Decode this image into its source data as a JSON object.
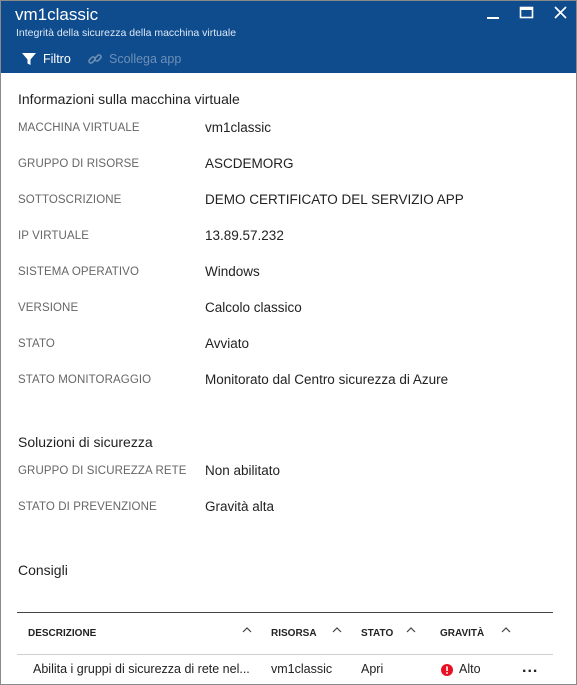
{
  "header": {
    "title": "vm1classic",
    "subtitle": "Integrità della sicurezza della macchina virtuale",
    "toolbar": {
      "filter_label": "Filtro",
      "disconnect_label": "Scollega app"
    },
    "window_controls": [
      "minimize-icon",
      "maximize-icon",
      "close-icon"
    ]
  },
  "vm_info": {
    "title": "Informazioni sulla macchina virtuale",
    "props": [
      {
        "label": "MACCHINA VIRTUALE",
        "value": "vm1classic"
      },
      {
        "label": "GRUPPO DI RISORSE",
        "value": "ASCDEMORG"
      },
      {
        "label": "SOTTOSCRIZIONE",
        "value": "DEMO CERTIFICATO DEL SERVIZIO APP"
      },
      {
        "label": "IP VIRTUALE",
        "value": "13.89.57.232"
      },
      {
        "label": "SISTEMA OPERATIVO",
        "value": "Windows"
      },
      {
        "label": "VERSIONE",
        "value": "Calcolo classico"
      },
      {
        "label": "STATO",
        "value": "Avviato"
      },
      {
        "label": "STATO MONITORAGGIO",
        "value": "Monitorato dal Centro sicurezza di Azure"
      }
    ]
  },
  "security_solutions": {
    "title": "Soluzioni di sicurezza",
    "props": [
      {
        "label": "GRUPPO DI SICUREZZA RETE",
        "value": "Non abilitato"
      },
      {
        "label": "STATO DI PREVENZIONE",
        "value": "Gravità alta"
      }
    ]
  },
  "recommendations": {
    "title": "Consigli",
    "columns": [
      "DESCRIZIONE",
      "RISORSA",
      "STATO",
      "GRAVITÀ"
    ],
    "rows": [
      {
        "description": "Abilita i gruppi di sicurezza di rete nel...",
        "resource": "vm1classic",
        "status": "Apri",
        "severity": "Alto",
        "more": "..."
      }
    ],
    "severity_color": "#e81123"
  },
  "colors": {
    "header_bg": "#0f4c8e",
    "disabled_tool": "#6e8fb6"
  }
}
